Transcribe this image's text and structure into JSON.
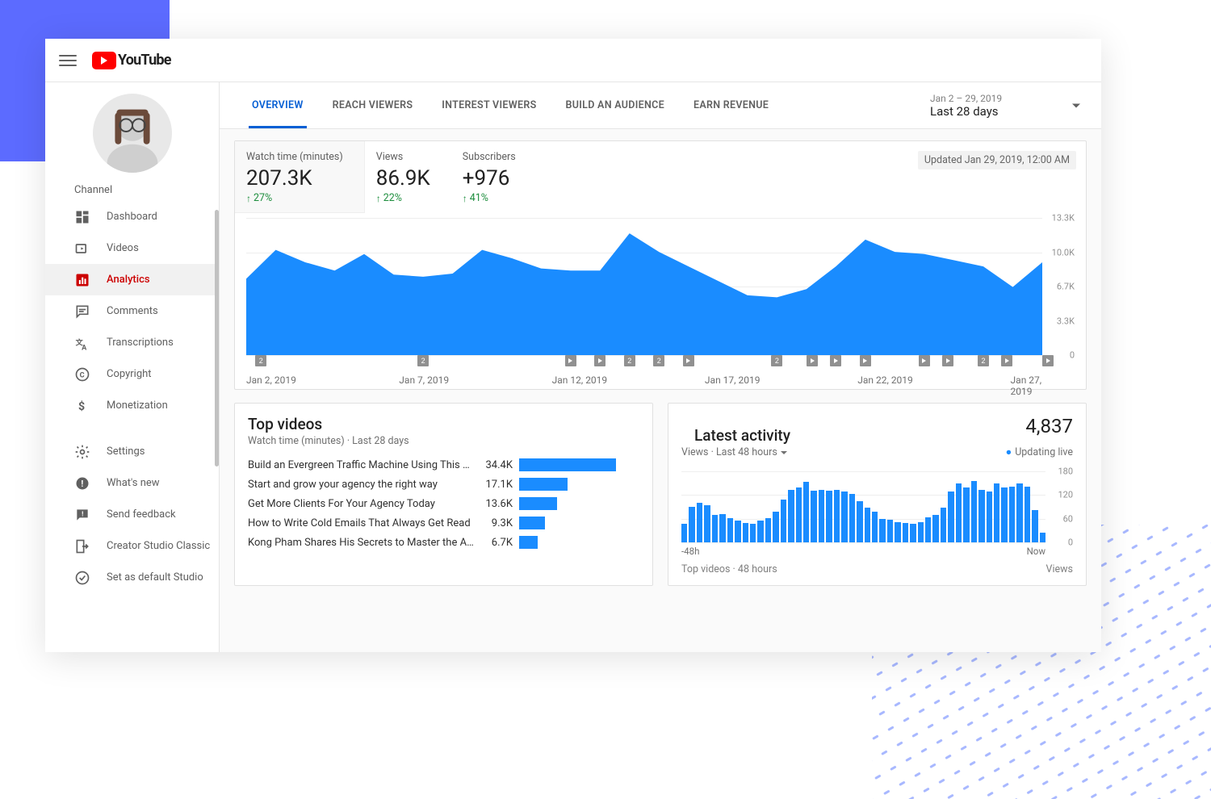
{
  "logo_text": "YouTube",
  "sidebar": {
    "channel_label": "Channel",
    "items": [
      {
        "label": "Dashboard",
        "icon": "dashboard"
      },
      {
        "label": "Videos",
        "icon": "videos"
      },
      {
        "label": "Analytics",
        "icon": "analytics",
        "active": true
      },
      {
        "label": "Comments",
        "icon": "comments"
      },
      {
        "label": "Transcriptions",
        "icon": "transcriptions"
      },
      {
        "label": "Copyright",
        "icon": "copyright"
      },
      {
        "label": "Monetization",
        "icon": "monetization"
      }
    ],
    "footer_items": [
      {
        "label": "Settings",
        "icon": "settings"
      },
      {
        "label": "What's new",
        "icon": "whatsnew"
      },
      {
        "label": "Send feedback",
        "icon": "feedback"
      },
      {
        "label": "Creator Studio Classic",
        "icon": "exit"
      },
      {
        "label": "Set as default Studio",
        "icon": "check"
      }
    ]
  },
  "tabs": [
    "OVERVIEW",
    "REACH VIEWERS",
    "INTEREST VIEWERS",
    "BUILD AN AUDIENCE",
    "EARN REVENUE"
  ],
  "date_picker": {
    "range": "Jan 2 – 29, 2019",
    "label": "Last 28 days"
  },
  "updated_text": "Updated Jan 29, 2019, 12:00 AM",
  "metrics": [
    {
      "label": "Watch time (minutes)",
      "value": "207.3K",
      "delta": "27%"
    },
    {
      "label": "Views",
      "value": "86.9K",
      "delta": "22%"
    },
    {
      "label": "Subscribers",
      "value": "+976",
      "delta": "41%"
    }
  ],
  "chart_data": {
    "type": "area",
    "title": "Watch time (minutes)",
    "ylim": [
      0,
      13300
    ],
    "y_ticks_display": [
      "13.3K",
      "10.0K",
      "6.7K",
      "3.3K",
      "0"
    ],
    "x_ticks_display": [
      "Jan 2, 2019",
      "Jan 7, 2019",
      "Jan 12, 2019",
      "Jan 17, 2019",
      "Jan 22, 2019",
      "Jan 27, 2019"
    ],
    "x": [
      "Jan 2",
      "Jan 3",
      "Jan 4",
      "Jan 5",
      "Jan 6",
      "Jan 7",
      "Jan 8",
      "Jan 9",
      "Jan 10",
      "Jan 11",
      "Jan 12",
      "Jan 13",
      "Jan 14",
      "Jan 15",
      "Jan 16",
      "Jan 17",
      "Jan 18",
      "Jan 19",
      "Jan 20",
      "Jan 21",
      "Jan 22",
      "Jan 23",
      "Jan 24",
      "Jan 25",
      "Jan 26",
      "Jan 27",
      "Jan 28",
      "Jan 29"
    ],
    "values": [
      7400,
      10200,
      9000,
      8200,
      9800,
      7800,
      7600,
      7900,
      10200,
      9400,
      8400,
      8200,
      8200,
      11800,
      10000,
      8600,
      7200,
      5800,
      5600,
      6400,
      8600,
      11200,
      10000,
      9800,
      9200,
      8600,
      6600,
      9000
    ],
    "markers": [
      {
        "pos": 0.5,
        "kind": "2"
      },
      {
        "pos": 6.0,
        "kind": "2"
      },
      {
        "pos": 11.0,
        "kind": "play"
      },
      {
        "pos": 12.0,
        "kind": "play"
      },
      {
        "pos": 13.0,
        "kind": "2"
      },
      {
        "pos": 14.0,
        "kind": "2"
      },
      {
        "pos": 15.0,
        "kind": "play"
      },
      {
        "pos": 18.0,
        "kind": "2"
      },
      {
        "pos": 19.2,
        "kind": "play"
      },
      {
        "pos": 20.0,
        "kind": "play"
      },
      {
        "pos": 21.0,
        "kind": "play"
      },
      {
        "pos": 23.0,
        "kind": "play"
      },
      {
        "pos": 23.8,
        "kind": "play"
      },
      {
        "pos": 25.0,
        "kind": "2"
      },
      {
        "pos": 25.8,
        "kind": "play"
      },
      {
        "pos": 27.2,
        "kind": "play"
      }
    ]
  },
  "top_videos": {
    "title": "Top videos",
    "subtitle": "Watch time (minutes) · Last 28 days",
    "max": 34400,
    "rows": [
      {
        "title": "Build an Evergreen Traffic Machine Using This Play…",
        "value": 34400,
        "display": "34.4K"
      },
      {
        "title": "Start and grow your agency the right way",
        "value": 17100,
        "display": "17.1K"
      },
      {
        "title": "Get More Clients For Your Agency Today",
        "value": 13600,
        "display": "13.6K"
      },
      {
        "title": "How to Write Cold Emails That Always Get Read",
        "value": 9300,
        "display": "9.3K"
      },
      {
        "title": "Kong Pham Shares His Secrets to Master the Art of …",
        "value": 6700,
        "display": "6.7K"
      }
    ]
  },
  "latest_activity": {
    "title": "Latest activity",
    "total": "4,837",
    "subtitle": "Views · Last 48 hours",
    "live_label": "Updating live",
    "x_left": "-48h",
    "x_right": "Now",
    "footer_left": "Top videos · 48 hours",
    "footer_right": "Views",
    "y_ticks": [
      "180",
      "120",
      "60",
      "0"
    ],
    "chart_data": {
      "type": "bar",
      "ylim": [
        0,
        180
      ],
      "values": [
        48,
        90,
        100,
        95,
        70,
        72,
        62,
        56,
        50,
        48,
        55,
        62,
        78,
        108,
        132,
        140,
        154,
        130,
        132,
        130,
        134,
        128,
        122,
        104,
        88,
        78,
        60,
        58,
        52,
        50,
        48,
        52,
        64,
        70,
        88,
        128,
        150,
        140,
        155,
        134,
        128,
        150,
        140,
        142,
        150,
        142,
        82,
        24
      ]
    }
  }
}
